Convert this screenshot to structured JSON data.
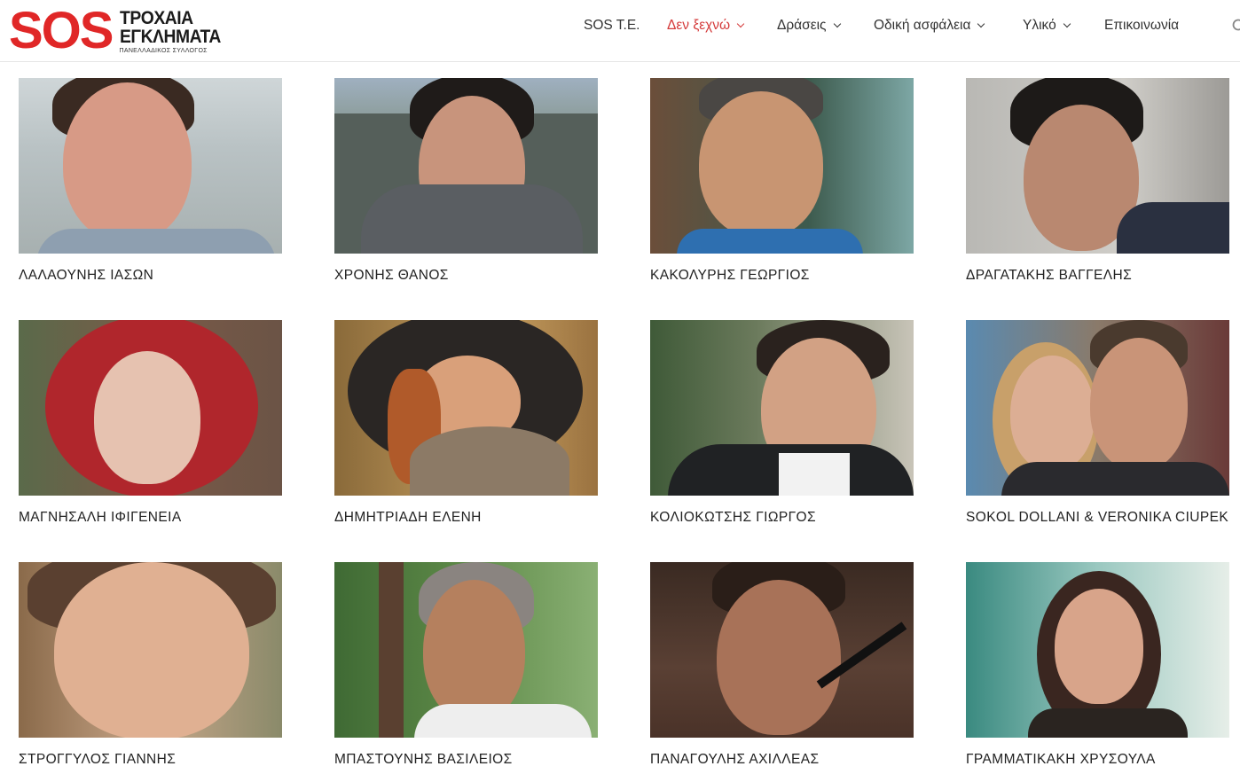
{
  "logo": {
    "sos": "SOS",
    "line1": "ΤΡΟΧΑΙΑ",
    "line2": "ΕΓΚΛΗΜΑΤΑ",
    "line3": "ΠΑΝΕΛΛΑΔΙΚΟΣ ΣΥΛΛΟΓΟΣ"
  },
  "nav": {
    "items": [
      {
        "label": "SOS T.E.",
        "has_dropdown": false,
        "active": false
      },
      {
        "label": "Δεν ξεχνώ",
        "has_dropdown": true,
        "active": true
      },
      {
        "label": "Δράσεις",
        "has_dropdown": true,
        "active": false
      },
      {
        "label": "Οδική ασφάλεια",
        "has_dropdown": true,
        "active": false
      },
      {
        "label": "Υλικό",
        "has_dropdown": true,
        "active": false
      },
      {
        "label": "Επικοινωνία",
        "has_dropdown": false,
        "active": false
      }
    ],
    "active_color": "#d43a3a"
  },
  "memorial": [
    {
      "name": "ΛΑΛΑΟΥΝΗΣ ΙΑΣΩΝ"
    },
    {
      "name": "ΧΡΟΝΗΣ ΘΑΝΟΣ"
    },
    {
      "name": "ΚΑΚΟΛΥΡΗΣ ΓΕΩΡΓΙΟΣ"
    },
    {
      "name": "ΔΡΑΓΑΤΑΚΗΣ ΒΑΓΓΕΛΗΣ"
    },
    {
      "name": "ΜΑΓΝΗΣΑΛΗ ΙΦΙΓΕΝΕΙΑ"
    },
    {
      "name": "ΔΗΜΗΤΡΙΑΔΗ ΕΛΕΝΗ"
    },
    {
      "name": "ΚΟΛΙΟΚΩΤΣΗΣ ΓΙΩΡΓΟΣ"
    },
    {
      "name": "SOKOL DOLLANI & VERONIKA CIUPEK"
    },
    {
      "name": "ΣΤΡΟΓΓΥΛΟΣ ΓΙΑΝΝΗΣ"
    },
    {
      "name": "ΜΠΑΣΤΟΥΝΗΣ ΒΑΣΙΛΕΙΟΣ"
    },
    {
      "name": "ΠΑΝΑΓΟΥΛΗΣ ΑΧΙΛΛΕΑΣ"
    },
    {
      "name": "ΓΡΑΜΜΑΤΙΚΑΚΗ ΧΡΥΣΟΥΛΑ"
    }
  ],
  "colors": {
    "brand_red": "#e02727",
    "text": "#222222"
  }
}
